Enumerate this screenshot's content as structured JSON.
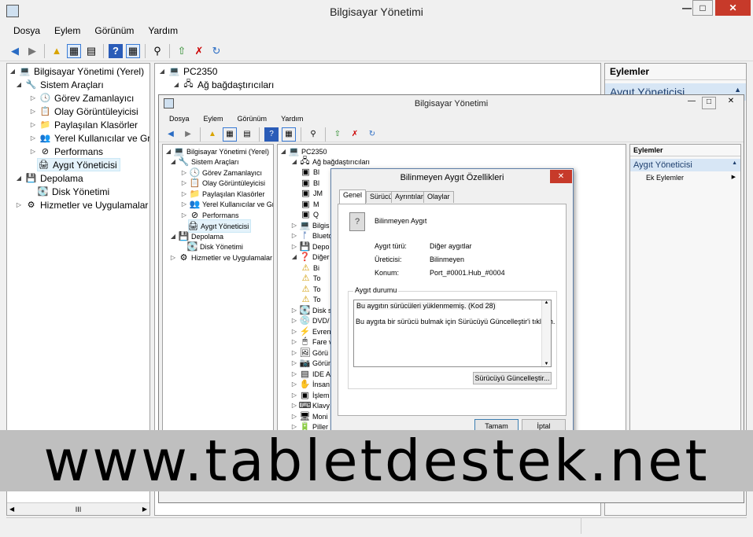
{
  "main": {
    "title": "Bilgisayar Yönetimi",
    "menu": [
      "Dosya",
      "Eylem",
      "Görünüm",
      "Yardım"
    ],
    "tree": [
      {
        "label": "Bilgisayar Yönetimi (Yerel)",
        "level": 0,
        "icon": "computer-icon"
      },
      {
        "label": "Sistem Araçları",
        "level": 1,
        "icon": "tools-icon"
      },
      {
        "label": "Görev Zamanlayıcı",
        "level": 2,
        "icon": "clock-icon"
      },
      {
        "label": "Olay Görüntüleyicisi",
        "level": 2,
        "icon": "event-viewer-icon"
      },
      {
        "label": "Paylaşılan Klasörler",
        "level": 2,
        "icon": "shared-folder-icon"
      },
      {
        "label": "Yerel Kullanıcılar ve Gru",
        "level": 2,
        "icon": "users-icon"
      },
      {
        "label": "Performans",
        "level": 2,
        "icon": "performance-icon"
      },
      {
        "label": "Aygıt Yöneticisi",
        "level": 2,
        "icon": "device-manager-icon"
      },
      {
        "label": "Depolama",
        "level": 1,
        "icon": "storage-icon"
      },
      {
        "label": "Disk Yönetimi",
        "level": 2,
        "icon": "disk-icon"
      },
      {
        "label": "Hizmetler ve Uygulamalar",
        "level": 1,
        "icon": "services-icon"
      }
    ],
    "center_tree": [
      "PC2350",
      "Ağ bağdaştırıcıları"
    ],
    "actions_header": "Eylemler",
    "actions_selected": "Aygıt Yöneticisi",
    "scroll_glyph": "III"
  },
  "second": {
    "title": "Bilgisayar Yönetimi",
    "menu": [
      "Dosya",
      "Eylem",
      "Görünüm",
      "Yardım"
    ],
    "tree": [
      {
        "label": "Bilgisayar Yönetimi (Yerel)",
        "level": 0
      },
      {
        "label": "Sistem Araçları",
        "level": 1
      },
      {
        "label": "Görev Zamanlayıcı",
        "level": 2
      },
      {
        "label": "Olay Görüntüleyicisi",
        "level": 2
      },
      {
        "label": "Paylaşılan Klasörler",
        "level": 2
      },
      {
        "label": "Yerel Kullanıcılar ve Gru",
        "level": 2
      },
      {
        "label": "Performans",
        "level": 2
      },
      {
        "label": "Aygıt Yöneticisi",
        "level": 2
      },
      {
        "label": "Depolama",
        "level": 1
      },
      {
        "label": "Disk Yönetimi",
        "level": 2
      },
      {
        "label": "Hizmetler ve Uygulamalar",
        "level": 1
      }
    ],
    "center_tree": [
      {
        "label": "PC2350",
        "level": 0
      },
      {
        "label": "Ağ bağdaştırıcıları",
        "level": 1
      },
      {
        "label": "Bl",
        "level": 2
      },
      {
        "label": "Bl",
        "level": 2
      },
      {
        "label": "JM",
        "level": 2
      },
      {
        "label": "M",
        "level": 2
      },
      {
        "label": "Q",
        "level": 2
      },
      {
        "label": "Bilgis",
        "level": 1
      },
      {
        "label": "Blueto",
        "level": 1
      },
      {
        "label": "Depo",
        "level": 1
      },
      {
        "label": "Diğer",
        "level": 1
      },
      {
        "label": "Bi",
        "level": 2
      },
      {
        "label": "To",
        "level": 2
      },
      {
        "label": "To",
        "level": 2
      },
      {
        "label": "To",
        "level": 2
      },
      {
        "label": "Disk s",
        "level": 1
      },
      {
        "label": "DVD/",
        "level": 1
      },
      {
        "label": "Evren",
        "level": 1
      },
      {
        "label": "Fare v",
        "level": 1
      },
      {
        "label": "Görü",
        "level": 1
      },
      {
        "label": "Görün",
        "level": 1
      },
      {
        "label": "IDE A",
        "level": 1
      },
      {
        "label": "İnsan",
        "level": 1
      },
      {
        "label": "İşlem",
        "level": 1
      },
      {
        "label": "Klavy",
        "level": 1
      },
      {
        "label": "Moni",
        "level": 1
      },
      {
        "label": "Piller",
        "level": 1
      }
    ],
    "actions_header": "Eylemler",
    "actions_selected": "Aygıt Yöneticisi",
    "actions_more": "Ek Eylemler"
  },
  "dialog": {
    "title": "Bilinmeyen Aygıt Özellikleri",
    "tabs": [
      "Genel",
      "Sürücü",
      "Ayrıntılar",
      "Olaylar"
    ],
    "device_name": "Bilinmeyen Aygıt",
    "props": [
      {
        "key": "Aygıt türü:",
        "value": "Diğer aygıtlar"
      },
      {
        "key": "Üreticisi:",
        "value": "Bilinmeyen"
      },
      {
        "key": "Konum:",
        "value": "Port_#0001.Hub_#0004"
      }
    ],
    "status_label": "Aygıt durumu",
    "status_line1": "Bu aygıtın sürücüleri yüklenmemiş. (Kod 28)",
    "status_line2": "Bu aygıta bir sürücü bulmak için Sürücüyü Güncelleştir'i tıklatın.",
    "update_button": "Sürücüyü Güncelleştir...",
    "ok_button": "Tamam",
    "cancel_button": "İptal"
  },
  "banner": "www.tabletdestek.net"
}
